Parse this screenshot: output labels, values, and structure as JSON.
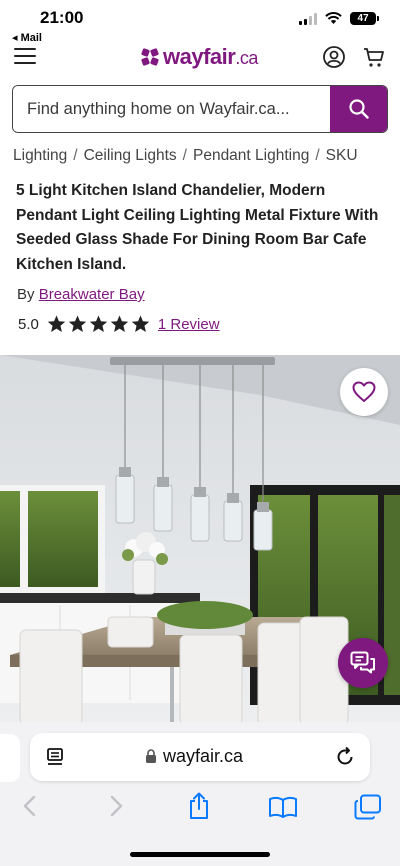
{
  "status_bar": {
    "time": "21:00",
    "back_app": "◂ Mail",
    "battery": "47"
  },
  "header": {
    "logo_text": "wayfair",
    "logo_tld": ".ca"
  },
  "search": {
    "placeholder": "Find anything home on Wayfair.ca..."
  },
  "breadcrumb": [
    "Lighting",
    "Ceiling Lights",
    "Pendant Lighting",
    "SKU"
  ],
  "breadcrumb_separator": "/",
  "product": {
    "title": "5 Light Kitchen Island Chandelier, Modern Pendant Light Ceiling Lighting Metal Fixture With Seeded Glass Shade For Dining Room Bar Cafe Kitchen Island.",
    "by_label": "By",
    "brand": "Breakwater Bay",
    "rating": "5.0",
    "stars": 5,
    "reviews": "1 Review"
  },
  "browser": {
    "url": "wayfair.ca"
  },
  "colors": {
    "brand_purple": "#7f187f",
    "text": "#222222",
    "safari_bar": "#f2f2f4",
    "ios_blue": "#0a7aff"
  },
  "icons": [
    "menu-icon",
    "account-icon",
    "cart-icon",
    "search-icon",
    "heart-icon",
    "chat-icon",
    "page-format-icon",
    "lock-icon",
    "reload-icon",
    "back-icon",
    "forward-icon",
    "share-icon",
    "bookmarks-icon",
    "tabs-icon"
  ]
}
